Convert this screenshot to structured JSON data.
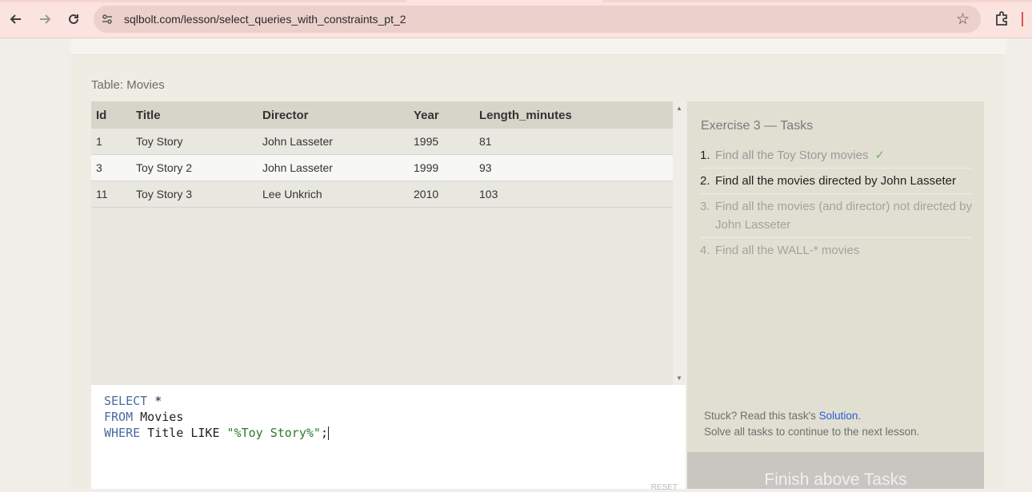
{
  "browser": {
    "url": "sqlbolt.com/lesson/select_queries_with_constraints_pt_2"
  },
  "page": {
    "table_caption": "Table: Movies",
    "columns": [
      "Id",
      "Title",
      "Director",
      "Year",
      "Length_minutes"
    ],
    "rows": [
      [
        "1",
        "Toy Story",
        "John Lasseter",
        "1995",
        "81"
      ],
      [
        "3",
        "Toy Story 2",
        "John Lasseter",
        "1999",
        "93"
      ],
      [
        "11",
        "Toy Story 3",
        "Lee Unkrich",
        "2010",
        "103"
      ]
    ],
    "query": {
      "line1_kw": "SELECT",
      "line1_rest": " *",
      "line2_kw": "FROM",
      "line2_rest": " Movies",
      "line3_kw": "WHERE",
      "line3_mid": " Title LIKE ",
      "line3_str": "\"%Toy Story%\"",
      "line3_end": ";"
    },
    "reset_hint": "RESET"
  },
  "tasks": {
    "title": "Exercise 3 — Tasks",
    "items": [
      {
        "num": "1.",
        "text": "Find all the Toy Story movies",
        "status": "done",
        "check": "✓"
      },
      {
        "num": "2.",
        "text": "Find all the movies directed by John Lasseter",
        "status": "current"
      },
      {
        "num": "3.",
        "text": "Find all the movies (and director) not directed by John Lasseter",
        "status": "pending"
      },
      {
        "num": "4.",
        "text": "Find all the WALL-* movies",
        "status": "pending"
      }
    ],
    "help_prefix": "Stuck? Read this task's ",
    "help_link": "Solution",
    "help_suffix": ".",
    "help_line2": "Solve all tasks to continue to the next lesson.",
    "finish_label": "Finish above Tasks"
  }
}
